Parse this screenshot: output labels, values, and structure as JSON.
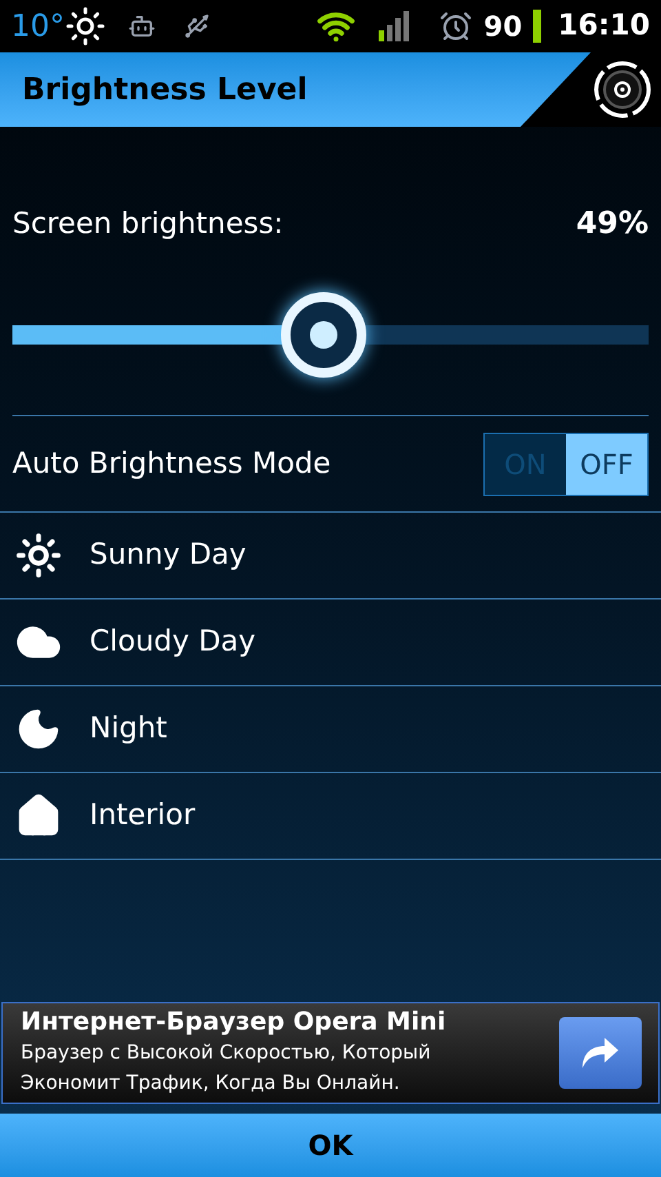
{
  "status_bar": {
    "temperature": "10°",
    "battery": "90",
    "time": "16:10"
  },
  "header": {
    "title": "Brightness Level"
  },
  "brightness": {
    "label": "Screen brightness:",
    "reading": "49%",
    "level": 0.49
  },
  "auto_mode": {
    "label": "Auto Brightness Mode",
    "options": [
      {
        "label": "ON",
        "selected": false
      },
      {
        "label": "OFF",
        "selected": true
      }
    ]
  },
  "presets": [
    {
      "kind": "sunny",
      "label": "Sunny Day"
    },
    {
      "kind": "cloudy",
      "label": "Cloudy Day"
    },
    {
      "kind": "night",
      "label": "Night"
    },
    {
      "kind": "interior",
      "label": "Interior"
    }
  ],
  "ad": {
    "title": "Интернет-Браузер Opera Mini",
    "body": "Браузер с Высокой Скоростью, Который Экономит Трафик, Когда Вы Онлайн."
  },
  "ok_button": "OK"
}
